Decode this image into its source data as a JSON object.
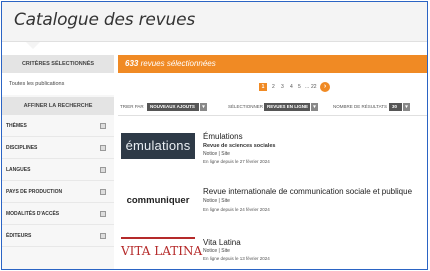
{
  "header": {
    "title": "Catalogue des revues"
  },
  "sidebar": {
    "criteria_heading": "CRITÈRES SÉLECTIONNÉS",
    "all_publications": "Toutes les publications",
    "refine_heading": "AFFINER LA RECHERCHE",
    "filters": [
      {
        "label": "THÈMES"
      },
      {
        "label": "DISCIPLINES"
      },
      {
        "label": "LANGUES"
      },
      {
        "label": "PAYS DE PRODUCTION"
      },
      {
        "label": "MODALITÉS D'ACCÈS"
      },
      {
        "label": "ÉDITEURS"
      }
    ]
  },
  "results": {
    "count": "633",
    "label": " revues sélectionnées"
  },
  "pagination": {
    "current": "1",
    "pages": [
      "2",
      "3",
      "4",
      "5"
    ],
    "ellipsis": "...",
    "last": "22",
    "next_icon": "chevron-right-icon",
    "next_glyph": "›"
  },
  "toolbar": {
    "sort_label": "TRIER PAR",
    "sort_value": "NOUVEAUX AJOUTS",
    "selection_label": "SÉLECTIONNER",
    "selection_value": "REVUES EN LIGNE",
    "count_label": "NOMBRE DE RÉSULTATS",
    "count_value": "30",
    "caret": "▾"
  },
  "revues": [
    {
      "logo_text": "émulations",
      "title": "Émulations",
      "subtitle": "Revue de sciences sociales",
      "links": "Notice  |  Site",
      "date": "En ligne depuis le 27 février 2024"
    },
    {
      "logo_text": "communiquer",
      "title": "Revue internationale de communication sociale et publique",
      "subtitle": "",
      "links": "Notice  |  Site",
      "date": "En ligne depuis le 24 février 2024"
    },
    {
      "logo_text": "VITA LATINA",
      "title": "Vita Latina",
      "subtitle": "",
      "links": "Notice  |  Site",
      "date": "En ligne depuis le 13 février 2024"
    }
  ],
  "colors": {
    "accent": "#f08a24",
    "frame": "#2b64c4"
  }
}
